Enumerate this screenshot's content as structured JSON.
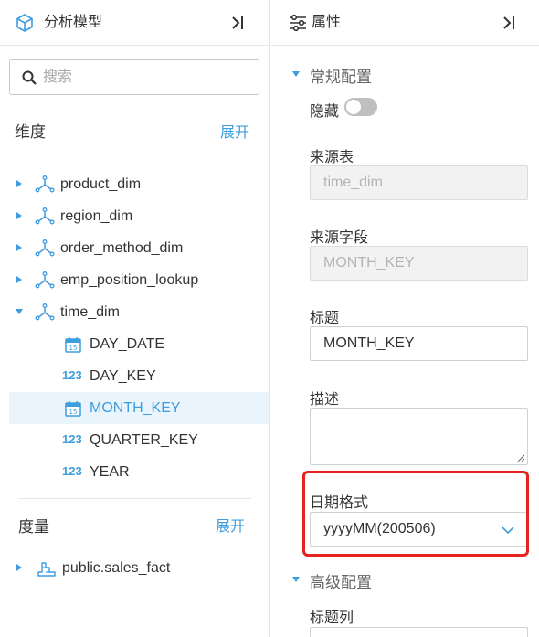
{
  "left_panel": {
    "title": "分析模型",
    "search": {
      "placeholder": "搜索",
      "value": ""
    },
    "dimensions": {
      "title": "维度",
      "action": "展开",
      "items": [
        {
          "label": "product_dim",
          "expanded": false
        },
        {
          "label": "region_dim",
          "expanded": false
        },
        {
          "label": "order_method_dim",
          "expanded": false
        },
        {
          "label": "emp_position_lookup",
          "expanded": false
        },
        {
          "label": "time_dim",
          "expanded": true,
          "children": [
            {
              "label": "DAY_DATE",
              "type": "date",
              "selected": false
            },
            {
              "label": "DAY_KEY",
              "type": "number",
              "selected": false
            },
            {
              "label": "MONTH_KEY",
              "type": "date",
              "selected": true
            },
            {
              "label": "QUARTER_KEY",
              "type": "number",
              "selected": false
            },
            {
              "label": "YEAR",
              "type": "number",
              "selected": false
            }
          ]
        }
      ]
    },
    "measures": {
      "title": "度量",
      "action": "展开",
      "items": [
        {
          "label": "public.sales_fact"
        }
      ]
    }
  },
  "right_panel": {
    "title": "属性",
    "general_section": {
      "title": "常规配置"
    },
    "hidden": {
      "label": "隐藏",
      "on": false
    },
    "source_table": {
      "label": "来源表",
      "value": "time_dim"
    },
    "source_field": {
      "label": "来源字段",
      "value": "MONTH_KEY"
    },
    "caption": {
      "label": "标题",
      "value": "MONTH_KEY"
    },
    "description": {
      "label": "描述",
      "value": ""
    },
    "date_format": {
      "label": "日期格式",
      "value": "yyyyMM(200506)"
    },
    "advanced_section": {
      "title": "高级配置"
    },
    "caption_column": {
      "label": "标题列"
    }
  },
  "colors": {
    "accent": "#3e9ddf",
    "highlight": "#e8231c",
    "selected_bg": "#e9f4fc"
  },
  "icons": {
    "left_header": "cube-icon",
    "right_header": "sliders-icon",
    "collapse": "collapse-right-icon",
    "dimension": "dimension-icon",
    "date_field": "calendar-icon",
    "number_field": "number-123-icon",
    "measure": "measure-icon"
  }
}
